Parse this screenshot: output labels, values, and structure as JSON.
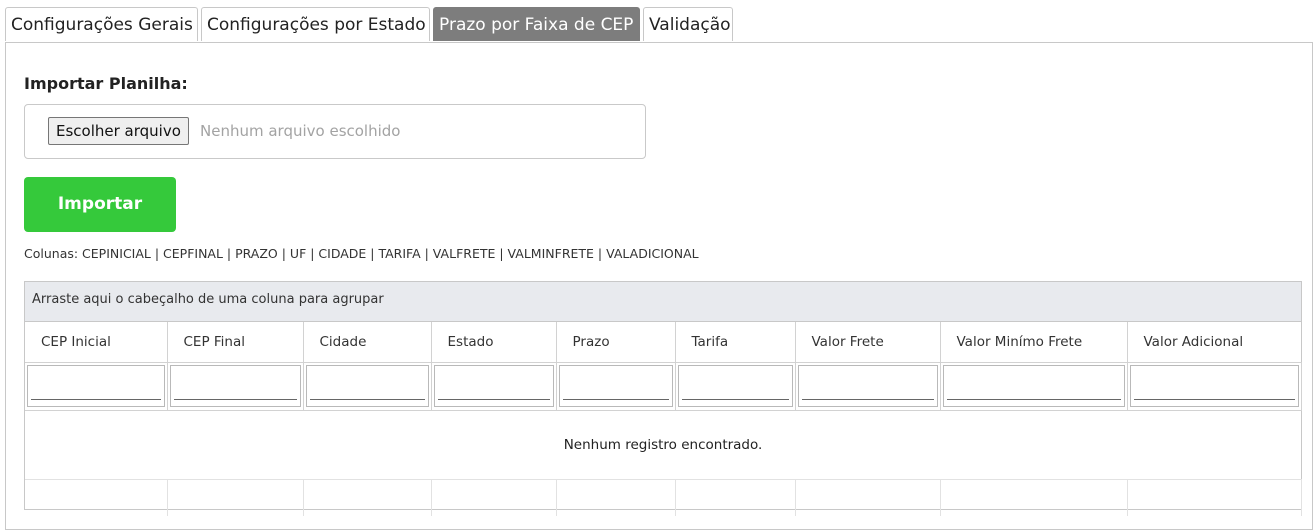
{
  "tabs": [
    {
      "label": "Configurações Gerais",
      "active": false
    },
    {
      "label": "Configurações por Estado",
      "active": false
    },
    {
      "label": "Prazo por Faixa de CEP",
      "active": true
    },
    {
      "label": "Validação",
      "active": false
    }
  ],
  "import": {
    "label": "Importar Planilha:",
    "file_button": "Escolher arquivo",
    "file_status": "Nenhum arquivo escolhido",
    "import_button": "Importar",
    "columns_text": "Colunas: CEPINICIAL | CEPFINAL | PRAZO | UF | CIDADE | TARIFA | VALFRETE | VALMINFRETE | VALADICIONAL"
  },
  "grid": {
    "group_hint": "Arraste aqui o cabeçalho de uma coluna para agrupar",
    "columns": [
      "CEP Inicial",
      "CEP Final",
      "Cidade",
      "Estado",
      "Prazo",
      "Tarifa",
      "Valor Frete",
      "Valor Minímo Frete",
      "Valor Adicional"
    ],
    "empty_message": "Nenhum registro encontrado."
  },
  "colors": {
    "active_tab": "#7d7d7d",
    "import_button": "#35c93b",
    "group_area": "#e8eaee"
  }
}
